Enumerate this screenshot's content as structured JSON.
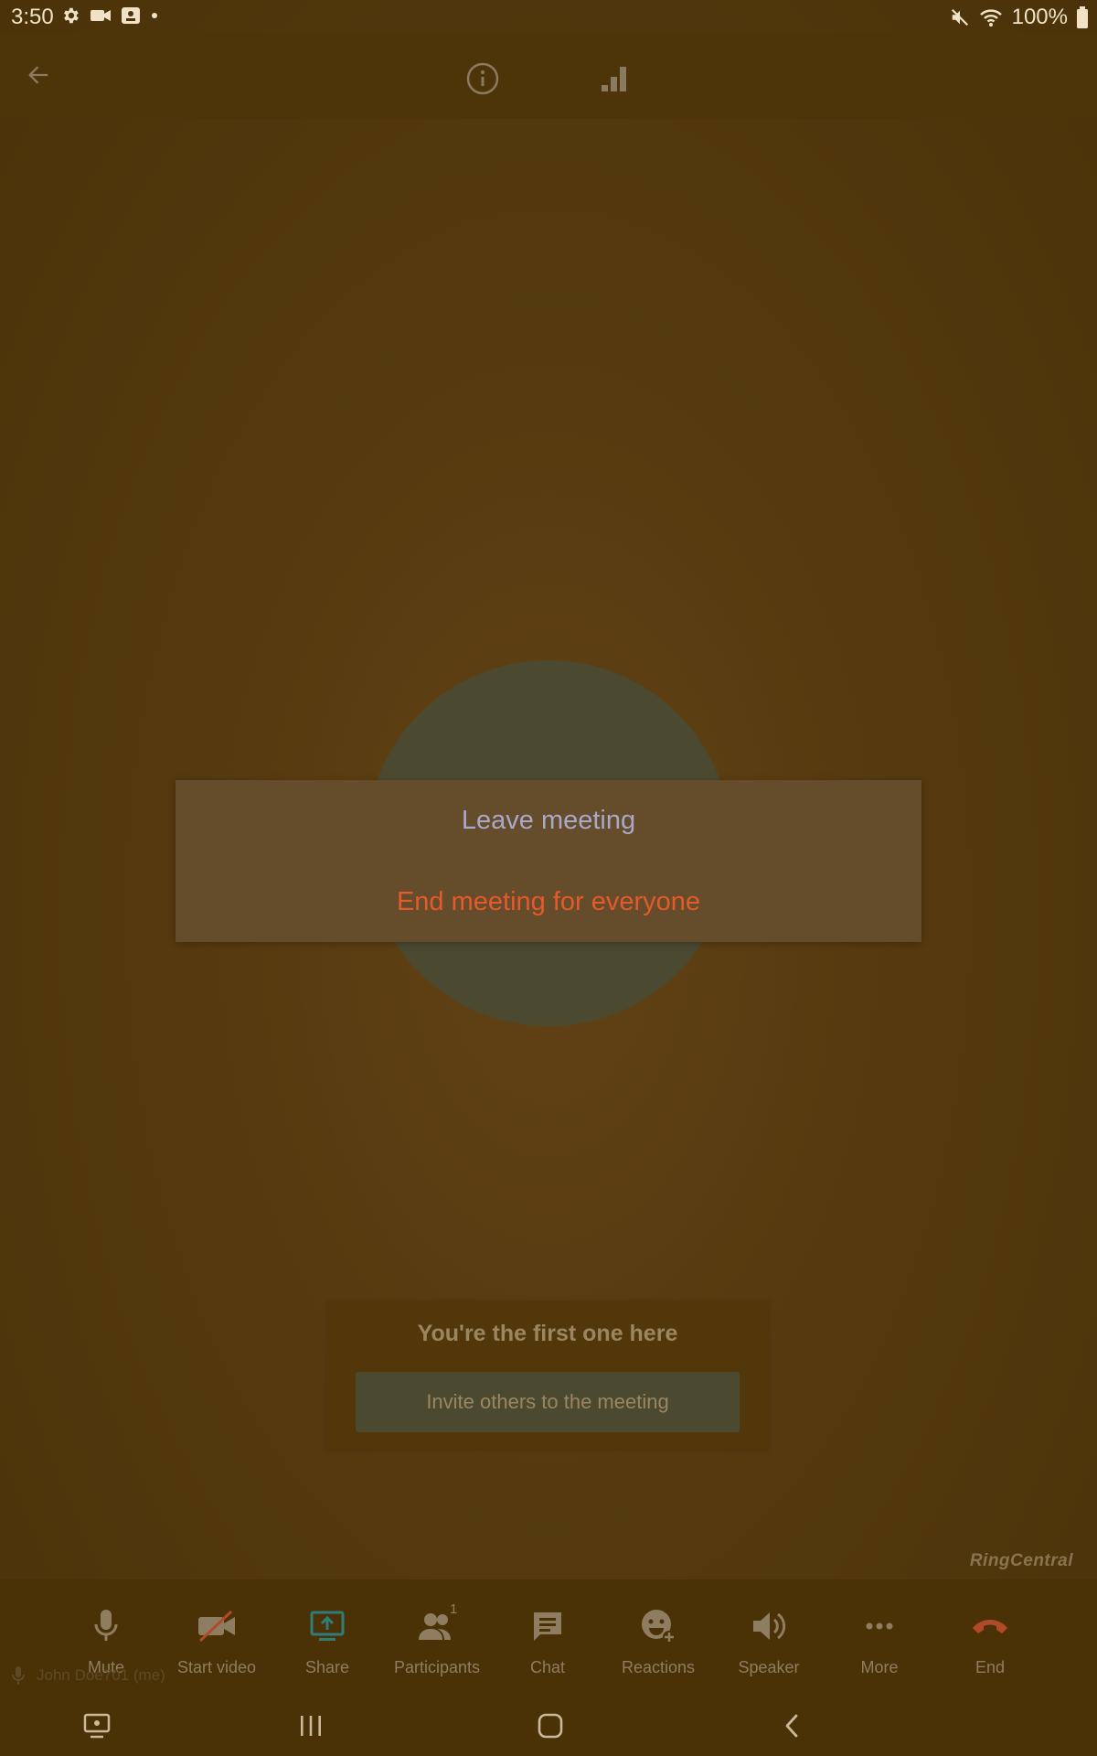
{
  "status_bar": {
    "time": "3:50",
    "battery": "100%"
  },
  "dialog": {
    "leave_label": "Leave meeting",
    "end_label": "End meeting for everyone"
  },
  "empty_state": {
    "title": "You're the first one here",
    "invite_label": "Invite others to the meeting"
  },
  "brand": "RingCentral",
  "toolbar": {
    "mute": "Mute",
    "start_video": "Start video",
    "share": "Share",
    "participants": "Participants",
    "participants_count": "1",
    "chat": "Chat",
    "reactions": "Reactions",
    "speaker": "Speaker",
    "more": "More",
    "end": "End"
  },
  "self_name": "John Doe701 (me)",
  "colors": {
    "accent_end": "#e45a2b",
    "share_teal": "#2f7c78",
    "leave_text": "#a8a8c8"
  }
}
